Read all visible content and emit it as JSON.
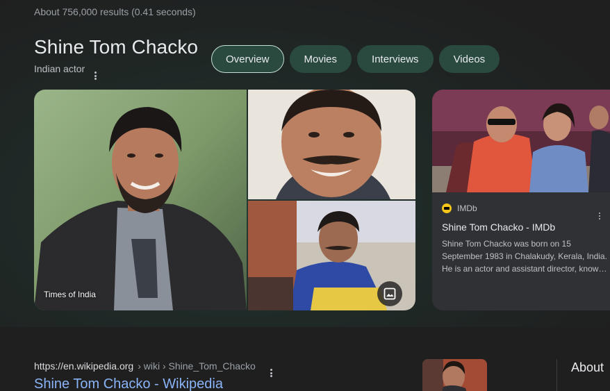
{
  "results_stats": "About 756,000 results (0.41 seconds)",
  "entity": {
    "title": "Shine Tom Chacko",
    "subtitle": "Indian actor"
  },
  "tabs": [
    {
      "label": "Overview",
      "active": true
    },
    {
      "label": "Movies",
      "active": false
    },
    {
      "label": "Interviews",
      "active": false
    },
    {
      "label": "Videos",
      "active": false
    }
  ],
  "images": {
    "main_caption": "Times of India",
    "badge_icon": "image-icon"
  },
  "imdb_card": {
    "source": "IMDb",
    "title": "Shine Tom Chacko - IMDb",
    "snippet": "Shine Tom Chacko was born on 15 September 1983 in Chalakudy, Kerala, India. He is an actor and assistant director, known for..."
  },
  "result": {
    "host": "https://en.wikipedia.org",
    "path": "› wiki › Shine_Tom_Chacko",
    "title": "Shine Tom Chacko - Wikipedia"
  },
  "about_heading": "About",
  "colors": {
    "background": "#1f1f1f",
    "tab_bg": "#2a4a40",
    "tab_active_border": "#c4e0d6",
    "link": "#8ab4f8",
    "card_bg": "#303134",
    "imdb_yellow": "#f5c518"
  }
}
